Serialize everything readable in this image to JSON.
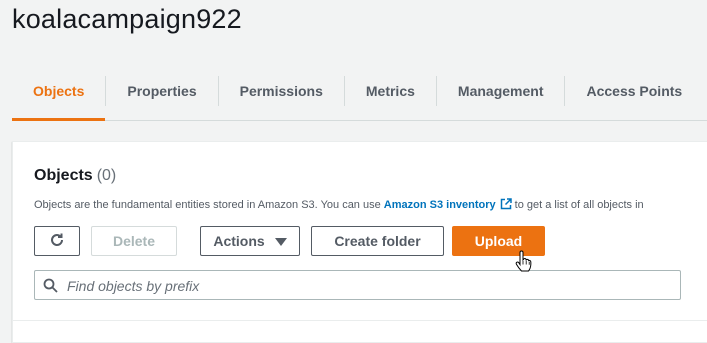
{
  "bucket": {
    "name": "koalacampaign922"
  },
  "tabs": [
    {
      "label": "Objects",
      "active": true
    },
    {
      "label": "Properties",
      "active": false
    },
    {
      "label": "Permissions",
      "active": false
    },
    {
      "label": "Metrics",
      "active": false
    },
    {
      "label": "Management",
      "active": false
    },
    {
      "label": "Access Points",
      "active": false
    }
  ],
  "objects_panel": {
    "title": "Objects",
    "count": "(0)",
    "description_before": "Objects are the fundamental entities stored in Amazon S3. You can use",
    "inventory_link": "Amazon S3 inventory",
    "description_after": "to get a list of all objects in"
  },
  "toolbar": {
    "refresh_icon": "refresh-icon",
    "delete_label": "Delete",
    "actions_label": "Actions",
    "create_folder_label": "Create folder",
    "upload_label": "Upload"
  },
  "search": {
    "placeholder": "Find objects by prefix",
    "value": ""
  },
  "colors": {
    "accent": "#ec7211",
    "link": "#0073bb",
    "text": "#16191f",
    "muted": "#545b64"
  }
}
